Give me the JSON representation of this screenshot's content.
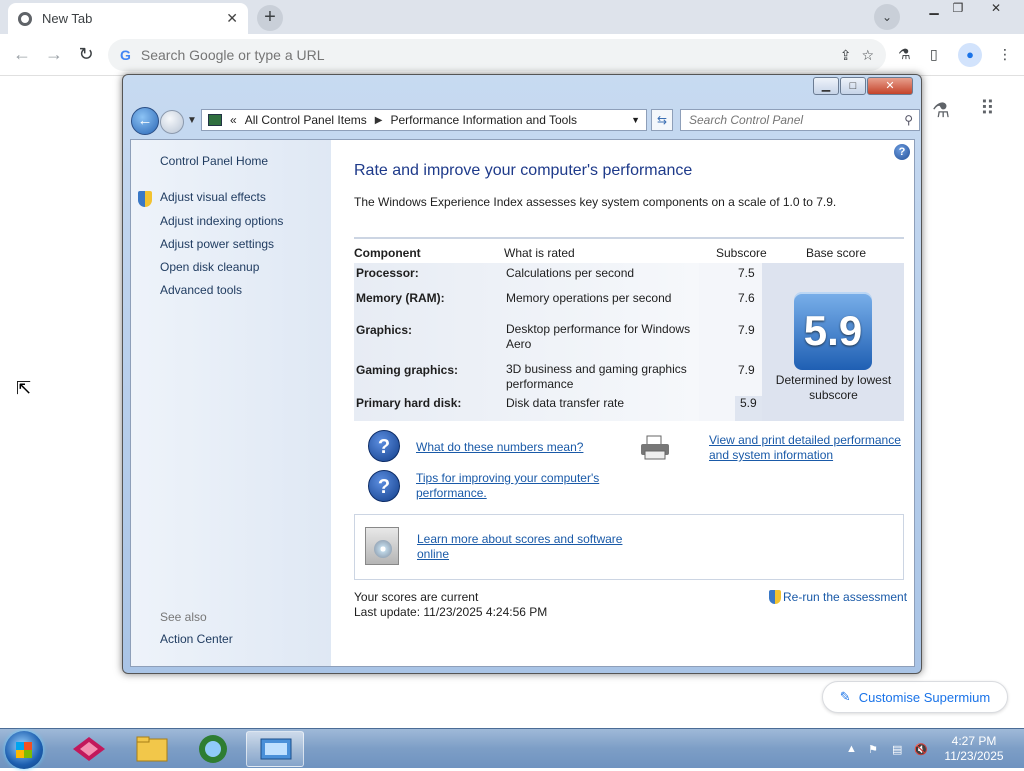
{
  "browser": {
    "tab_title": "New Tab",
    "omnibox_placeholder": "Search Google or type a URL",
    "customise_label": "Customise Supermium"
  },
  "window": {
    "breadcrumb": [
      "All Control Panel Items",
      "Performance Information and Tools"
    ],
    "breadcrumb_prefix": "«",
    "search_placeholder": "Search Control Panel"
  },
  "sidebar": {
    "home": "Control Panel Home",
    "items": [
      {
        "label": "Adjust visual effects"
      },
      {
        "label": "Adjust indexing options"
      },
      {
        "label": "Adjust power settings"
      },
      {
        "label": "Open disk cleanup"
      },
      {
        "label": "Advanced tools"
      }
    ],
    "see_also": "See also",
    "action_center": "Action Center"
  },
  "main": {
    "title": "Rate and improve your computer's performance",
    "description": "The Windows Experience Index assesses key system components on a scale of 1.0 to 7.9.",
    "columns": [
      "Component",
      "What is rated",
      "Subscore",
      "Base score"
    ],
    "rows": [
      {
        "component": "Processor:",
        "rated": "Calculations per second",
        "subscore": "7.5"
      },
      {
        "component": "Memory (RAM):",
        "rated": "Memory operations per second",
        "subscore": "7.6"
      },
      {
        "component": "Graphics:",
        "rated": "Desktop performance for Windows Aero",
        "subscore": "7.9"
      },
      {
        "component": "Gaming graphics:",
        "rated": "3D business and gaming graphics performance",
        "subscore": "7.9"
      },
      {
        "component": "Primary hard disk:",
        "rated": "Disk data transfer rate",
        "subscore": "5.9"
      }
    ],
    "base_score": "5.9",
    "determined_by": "Determined by lowest subscore",
    "link_numbers": "What do these numbers mean?",
    "link_tips": "Tips for improving your computer's performance.",
    "link_print": "View and print detailed performance and system information",
    "link_learn": "Learn more about scores and software online",
    "status_current": "Your scores are current",
    "status_last_update": "Last update: 11/23/2025 4:24:56 PM",
    "rerun": "Re-run the assessment"
  },
  "taskbar": {
    "time": "4:27 PM",
    "date": "11/23/2025"
  }
}
